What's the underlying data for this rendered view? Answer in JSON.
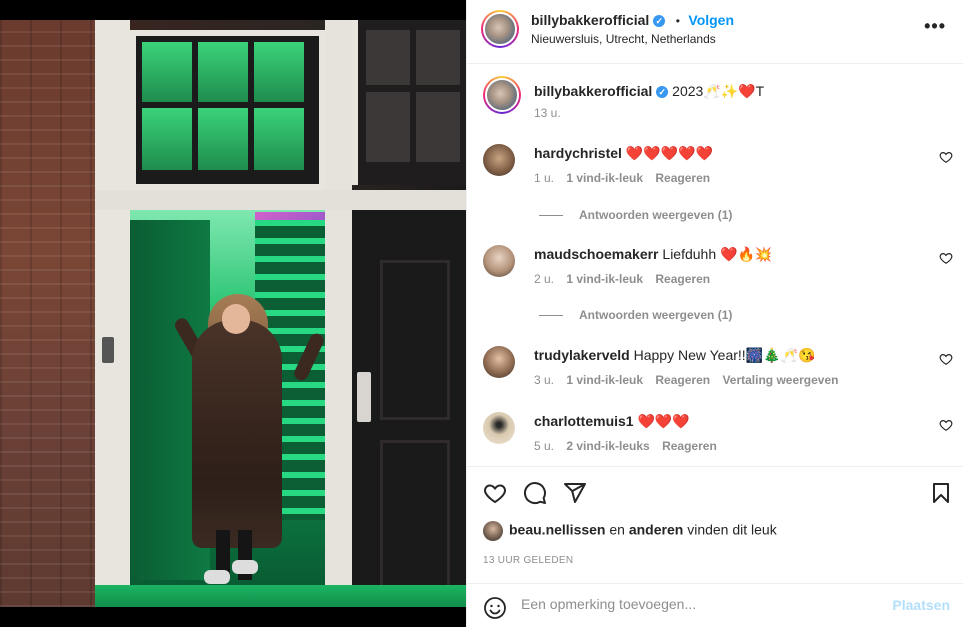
{
  "post": {
    "username": "billybakkerofficial",
    "follow_label": "Volgen",
    "separator": "•",
    "location": "Nieuwersluis, Utrecht, Netherlands",
    "caption": "2023🥂✨❤️T",
    "caption_time": "13 u."
  },
  "comments": [
    {
      "username": "hardychristel",
      "text": "❤️❤️❤️❤️❤️",
      "time": "1 u.",
      "likes": "1 vind-ik-leuk",
      "reply": "Reageren",
      "translate": "",
      "view_replies": "Antwoorden weergeven (1)"
    },
    {
      "username": "maudschoemakerr",
      "text": "Liefduhh ❤️🔥💥",
      "time": "2 u.",
      "likes": "1 vind-ik-leuk",
      "reply": "Reageren",
      "translate": "",
      "view_replies": "Antwoorden weergeven (1)"
    },
    {
      "username": "trudylakerveld",
      "text": "Happy New Year!!🎆🎄🥂😘",
      "time": "3 u.",
      "likes": "1 vind-ik-leuk",
      "reply": "Reageren",
      "translate": "Vertaling weergeven",
      "view_replies": ""
    },
    {
      "username": "charlottemuis1",
      "text": "❤️❤️❤️",
      "time": "5 u.",
      "likes": "2 vind-ik-leuks",
      "reply": "Reageren",
      "translate": "",
      "view_replies": ""
    }
  ],
  "likes": {
    "liker": "beau.nellissen",
    "connector": "en",
    "others": "anderen",
    "suffix": "vinden dit leuk"
  },
  "timestamp": "13 UUR GELEDEN",
  "composer": {
    "placeholder": "Een opmerking toevoegen...",
    "post_label": "Plaatsen"
  },
  "icons": {
    "more": "more-options-icon",
    "heart": "heart-icon",
    "comment": "comment-icon",
    "share": "share-icon",
    "save": "bookmark-icon",
    "emoji": "emoji-icon"
  },
  "colors": {
    "accent": "#0095f6",
    "verified": "#3897f0",
    "muted": "#8e8e8e",
    "post_disabled": "#b2dffc"
  }
}
